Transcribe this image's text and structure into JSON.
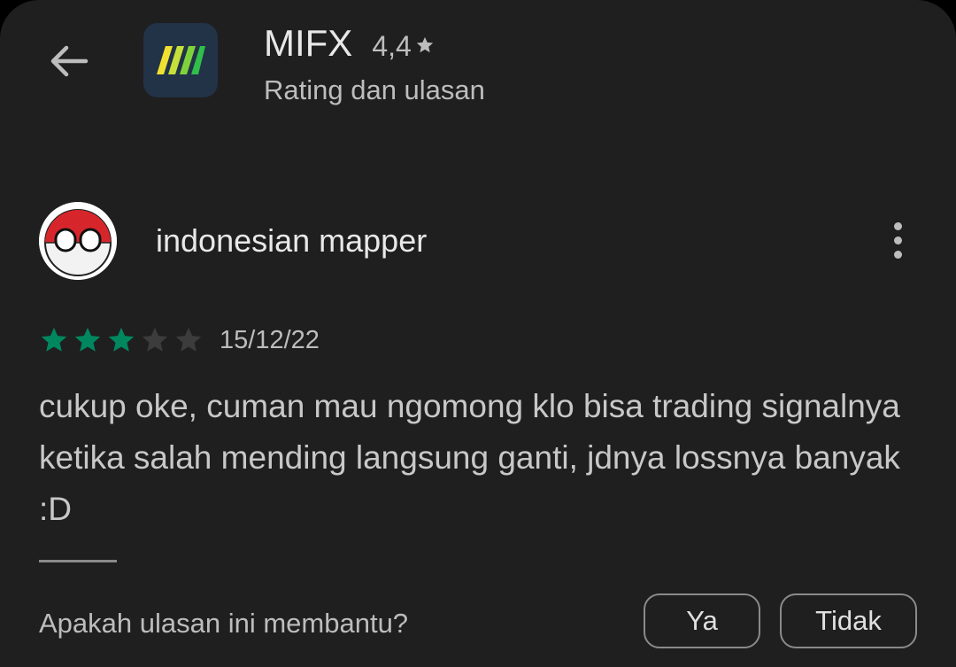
{
  "header": {
    "back_icon": "arrow-left-icon",
    "app_icon": "mifx-logo-icon",
    "app_name": "MIFX",
    "app_rating": "4,4",
    "rating_icon": "star-icon",
    "subtitle": "Rating dan ulasan"
  },
  "review": {
    "avatar_icon": "indonesia-countryball-avatar",
    "reviewer_name": "indonesian mapper",
    "more_icon": "more-vert-icon",
    "star_rating": 3,
    "star_max": 5,
    "date": "15/12/22",
    "text": "cukup oke, cuman mau ngomong klo bisa trading signalnya ketika salah mending langsung ganti, jdnya lossnya banyak :D"
  },
  "helpful": {
    "question": "Apakah ulasan ini membantu?",
    "yes_label": "Ya",
    "no_label": "Tidak"
  },
  "colors": {
    "background": "#1f1f1f",
    "star_filled": "#01875f",
    "star_empty": "#3c3c3c",
    "app_icon_bg": "#223247"
  }
}
